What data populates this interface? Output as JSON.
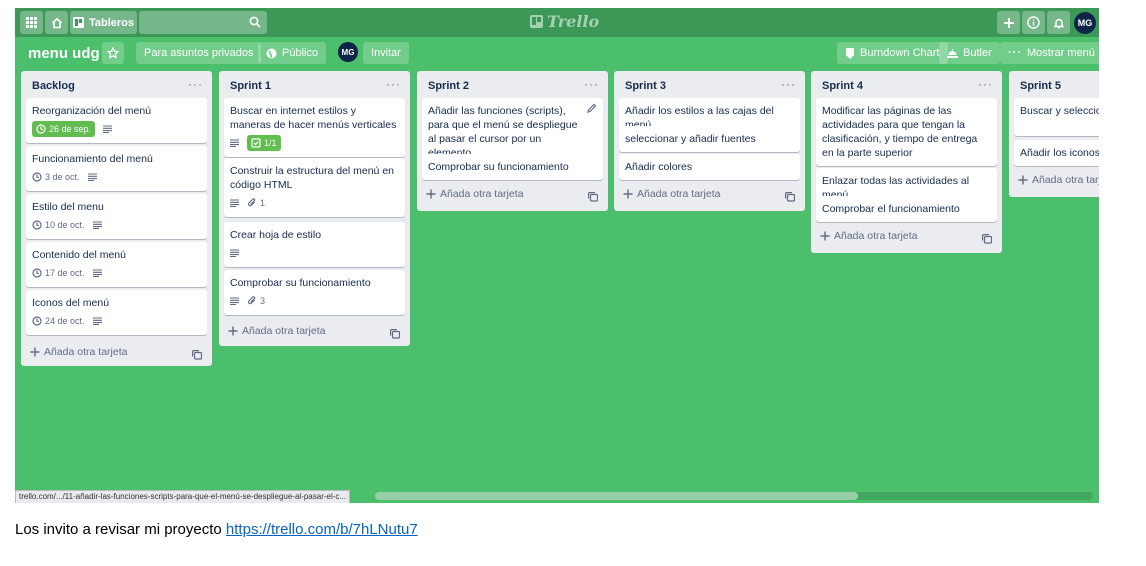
{
  "header": {
    "boards_label": "Tableros",
    "search_placeholder": "",
    "logo": "Trello",
    "avatar": "MG"
  },
  "board": {
    "title": "menu udg",
    "visibility_team": "Para asuntos privados",
    "visibility": "Público",
    "member_avatar": "MG",
    "invite": "Invitar",
    "powerup": "Burndown Chart",
    "butler": "Butler",
    "show_menu": "Mostrar menú"
  },
  "add_card_label": "Añada otra tarjeta",
  "lists": [
    {
      "title": "Backlog",
      "cards": [
        {
          "text": "Reorganización del menú",
          "date": "26 de sep.",
          "date_green": true,
          "desc": true
        },
        {
          "text": "Funcionamiento del menú",
          "date": "3 de oct.",
          "desc": true
        },
        {
          "text": "Estilo del menu",
          "date": "10 de oct.",
          "desc": true
        },
        {
          "text": "Contenido del menú",
          "date": "17 de oct.",
          "desc": true
        },
        {
          "text": "Iconos del menú",
          "date": "24 de oct.",
          "desc": true
        }
      ]
    },
    {
      "title": "Sprint 1",
      "cards": [
        {
          "text": "Buscar en internet estilos y maneras de hacer menús verticales",
          "desc": true,
          "checklist": "1/1"
        },
        {
          "text": "Construir la estructura del menú en código HTML",
          "desc": true,
          "attachments": "1"
        },
        {
          "text": "Crear hoja de estilo",
          "desc": true
        },
        {
          "text": "Comprobar su funcionamiento",
          "desc": true,
          "attachments": "3"
        }
      ]
    },
    {
      "title": "Sprint 2",
      "cards": [
        {
          "text": "Añadir las funciones (scripts), para que el menú se despliegue al pasar el cursor por un elemento",
          "editing": true
        },
        {
          "text": "Comprobar su funcionamiento"
        }
      ]
    },
    {
      "title": "Sprint 3",
      "cards": [
        {
          "text": "Añadir los estilos a las cajas del menú"
        },
        {
          "text": "seleccionar y añadir fuentes"
        },
        {
          "text": "Añadir colores"
        }
      ]
    },
    {
      "title": "Sprint 4",
      "cards": [
        {
          "text": "Modificar las páginas de las actividades para que tengan la clasificación, y tiempo de entrega en la parte superior"
        },
        {
          "text": "Enlazar todas las actividades al menú"
        },
        {
          "text": "Comprobar el funcionamiento"
        }
      ]
    },
    {
      "title": "Sprint 5",
      "cards": [
        {
          "text": "Buscar y seleccionar actividades"
        },
        {
          "text": "Añadir los iconos a"
        }
      ]
    }
  ],
  "status_url": "trello.com/.../11-añadir-las-funciones-scripts-para-que-el-menú-se-despliegue-al-pasar-el-c...",
  "caption": {
    "text": "Los invito a revisar mi proyecto ",
    "link": "https://trello.com/b/7hLNutu7"
  },
  "colors": {
    "board_bg": "#4bbf6b",
    "header_bg": "#3c9856",
    "due_green": "#61bd4f",
    "avatar": "#0f2547"
  }
}
